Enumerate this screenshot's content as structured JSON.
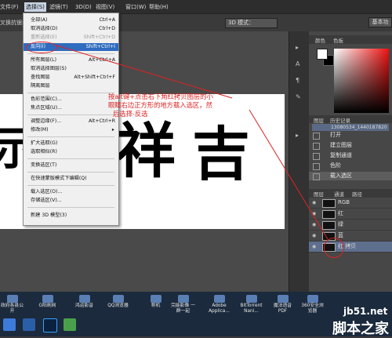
{
  "menubar": {
    "items": [
      "文件(F)",
      "选择(S)",
      "滤镜(T)",
      "3D(D)",
      "视图(V)",
      "窗口(W)",
      "帮助(H)"
    ]
  },
  "options": {
    "left_text": "叉换抗锯齿",
    "mode3d": "3D 模式：",
    "workspace": "基本功"
  },
  "select_menu": {
    "items": [
      {
        "label": "全部(A)",
        "shortcut": "Ctrl+A"
      },
      {
        "label": "取消选择(D)",
        "shortcut": "Ctrl+D"
      },
      {
        "label": "重新选择(E)",
        "shortcut": "Shift+Ctrl+D"
      },
      {
        "label": "反向(I)",
        "shortcut": "Shift+Ctrl+I"
      },
      {
        "label": "所有图层(L)",
        "shortcut": "Alt+Ctrl+A"
      },
      {
        "label": "取消选择图层(S)",
        "shortcut": ""
      },
      {
        "label": "查找图层",
        "shortcut": "Alt+Shift+Ctrl+F"
      },
      {
        "label": "隔离图层",
        "shortcut": ""
      },
      {
        "label": "色彩范围(C)...",
        "shortcut": ""
      },
      {
        "label": "焦点区域(U)...",
        "shortcut": ""
      },
      {
        "label": "调整边缘(F)...",
        "shortcut": "Alt+Ctrl+R"
      },
      {
        "label": "修改(M)",
        "shortcut": ""
      },
      {
        "label": "扩大选取(G)",
        "shortcut": ""
      },
      {
        "label": "选取相似(R)",
        "shortcut": ""
      },
      {
        "label": "变换选区(T)",
        "shortcut": ""
      },
      {
        "label": "在快速蒙版模式下编辑(Q)",
        "shortcut": ""
      },
      {
        "label": "载入选区(O)...",
        "shortcut": ""
      },
      {
        "label": "存储选区(V)...",
        "shortcut": ""
      },
      {
        "label": "新建 3D 模型(3)",
        "shortcut": ""
      }
    ]
  },
  "annotation": {
    "line1": "按alt键+点击右下角红拷贝图层的小",
    "line2": "眼睛右边正方形的地方载入选区，然",
    "line3": "后选择-反选"
  },
  "canvas": {
    "chars": [
      "示",
      "祥",
      "吉"
    ]
  },
  "color_panel": {
    "tabs": [
      "颜色",
      "色板"
    ]
  },
  "history": {
    "tabs": [
      "图层",
      "历史记录"
    ],
    "snapshot": "13080534_1440187820",
    "items": [
      "打开",
      "建立图层",
      "复制通道",
      "色阶",
      "载入选区"
    ]
  },
  "layers": {
    "tabs": [
      "图层",
      "通道",
      "路径"
    ],
    "rows": [
      "RGB",
      "红",
      "绿",
      "蓝",
      "红 拷贝"
    ]
  },
  "taskbar": {
    "items": [
      "政府各县公开",
      "G阳刷网",
      "鸿运影音",
      "QQ浏览器",
      "称机",
      "完能影像 一群一起",
      "Adobe Applica...",
      "BitTorrent Nani...",
      "魔法语音 PDF",
      "360安全浏览器"
    ]
  },
  "watermark": {
    "domain": "jb51.net",
    "name": "脚本之家"
  },
  "colors": {
    "highlight": "#2f6cc0",
    "annotation": "#dd2222"
  }
}
